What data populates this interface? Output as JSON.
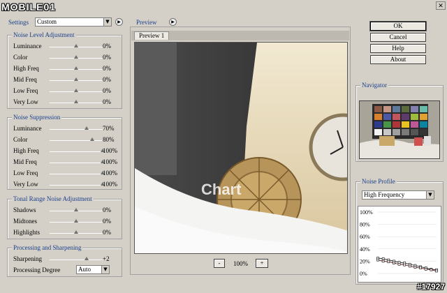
{
  "watermark": {
    "top": "MOBILE01",
    "bottom": "#17927"
  },
  "settings": {
    "label": "Settings",
    "value": "Custom"
  },
  "preview": {
    "label": "Preview",
    "tab": "Preview 1",
    "zoom": "100%",
    "zoom_out": "-",
    "zoom_in": "+",
    "watermark_text": "Chart"
  },
  "buttons": {
    "ok": "OK",
    "cancel": "Cancel",
    "help": "Help",
    "about": "About"
  },
  "noise_level": {
    "title": "Noise Level Adjustment",
    "rows": [
      {
        "label": "Luminance",
        "value": "0%",
        "pos": 0.5
      },
      {
        "label": "Color",
        "value": "0%",
        "pos": 0.5
      },
      {
        "label": "High Freq",
        "value": "0%",
        "pos": 0.5
      },
      {
        "label": "Mid Freq",
        "value": "0%",
        "pos": 0.5
      },
      {
        "label": "Low Freq",
        "value": "0%",
        "pos": 0.5
      },
      {
        "label": "Very Low",
        "value": "0%",
        "pos": 0.5
      }
    ]
  },
  "noise_suppression": {
    "title": "Noise Suppression",
    "rows": [
      {
        "label": "Luminance",
        "value": "70%",
        "pos": 0.7
      },
      {
        "label": "Color",
        "value": "80%",
        "pos": 0.8
      },
      {
        "label": "High Freq",
        "value": "100%",
        "pos": 1.0
      },
      {
        "label": "Mid Freq",
        "value": "100%",
        "pos": 1.0
      },
      {
        "label": "Low Freq",
        "value": "100%",
        "pos": 1.0
      },
      {
        "label": "Very Low",
        "value": "100%",
        "pos": 1.0
      }
    ]
  },
  "tonal": {
    "title": "Tonal Range Noise Adjustment",
    "rows": [
      {
        "label": "Shadows",
        "value": "0%",
        "pos": 0.5
      },
      {
        "label": "Midtones",
        "value": "0%",
        "pos": 0.5
      },
      {
        "label": "Highlights",
        "value": "0%",
        "pos": 0.5
      }
    ]
  },
  "processing": {
    "title": "Processing and Sharpening",
    "sharpening_label": "Sharpening",
    "sharpening_value": "+2",
    "sharpening_pos": 0.7,
    "degree_label": "Processing Degree",
    "degree_value": "Auto"
  },
  "navigator": {
    "title": "Navigator"
  },
  "noise_profile": {
    "title": "Noise Profile",
    "value": "High Frequency",
    "y_ticks": [
      "100%",
      "80%",
      "60%",
      "40%",
      "20%",
      "0%"
    ]
  },
  "chart_data": {
    "type": "line",
    "y_ticks": [
      "100%",
      "80%",
      "60%",
      "40%",
      "20%",
      "0%"
    ],
    "ylim": [
      0,
      100
    ],
    "series": [
      {
        "values": [
          25,
          24,
          22,
          20,
          18,
          17,
          15,
          13,
          11,
          9,
          7,
          6
        ]
      },
      {
        "values": [
          22,
          20,
          19,
          17,
          15,
          14,
          12,
          10,
          9,
          7,
          6,
          4
        ]
      }
    ]
  },
  "colors": {
    "accent": "#1a3f8a",
    "bg": "#d4d0c8"
  }
}
